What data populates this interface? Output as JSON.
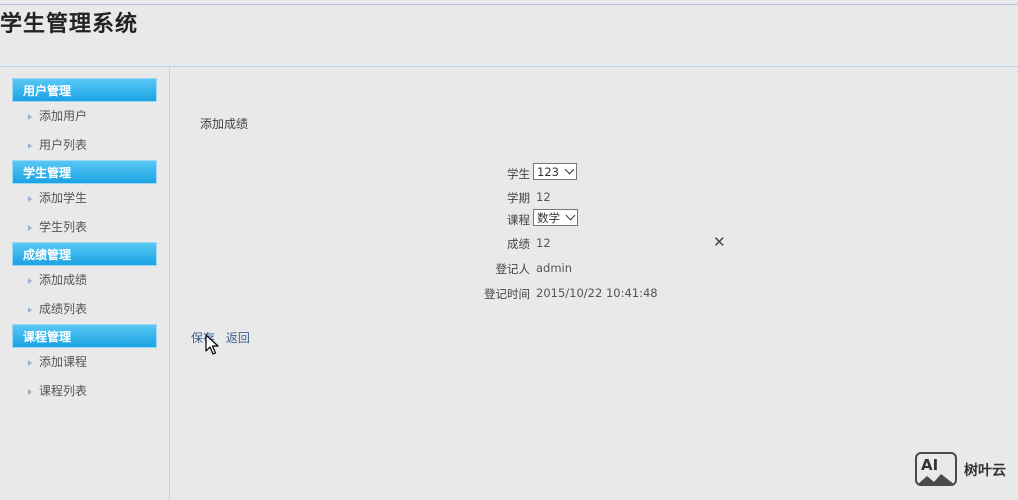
{
  "app": {
    "title": "学生管理系统"
  },
  "sidebar": {
    "sections": [
      {
        "title": "用户管理",
        "items": [
          "添加用户",
          "用户列表"
        ]
      },
      {
        "title": "学生管理",
        "items": [
          "添加学生",
          "学生列表"
        ]
      },
      {
        "title": "成绩管理",
        "items": [
          "添加成绩",
          "成绩列表"
        ]
      },
      {
        "title": "课程管理",
        "items": [
          "添加课程",
          "课程列表"
        ]
      }
    ]
  },
  "main": {
    "heading": "添加成绩",
    "form": {
      "student": {
        "label": "学生",
        "value": "123"
      },
      "term": {
        "label": "学期",
        "value": "12"
      },
      "course": {
        "label": "课程",
        "value": "数学"
      },
      "score": {
        "label": "成绩",
        "value": "12"
      },
      "recorder": {
        "label": "登记人",
        "value": "admin"
      },
      "record_time": {
        "label": "登记时间",
        "value": "2015/10/22 10:41:48"
      }
    },
    "actions": {
      "save": "保存",
      "back": "返回"
    }
  },
  "watermark": {
    "logo": "AI",
    "text": "树叶云"
  },
  "colors": {
    "sidebar_header": "#1ba3e4",
    "link": "#3b5f8f",
    "background": "#e9e9e9"
  },
  "icons": {
    "clear": "close-icon",
    "select": "chevron-down-icon",
    "sidebar_item": "triangle-right-icon"
  }
}
